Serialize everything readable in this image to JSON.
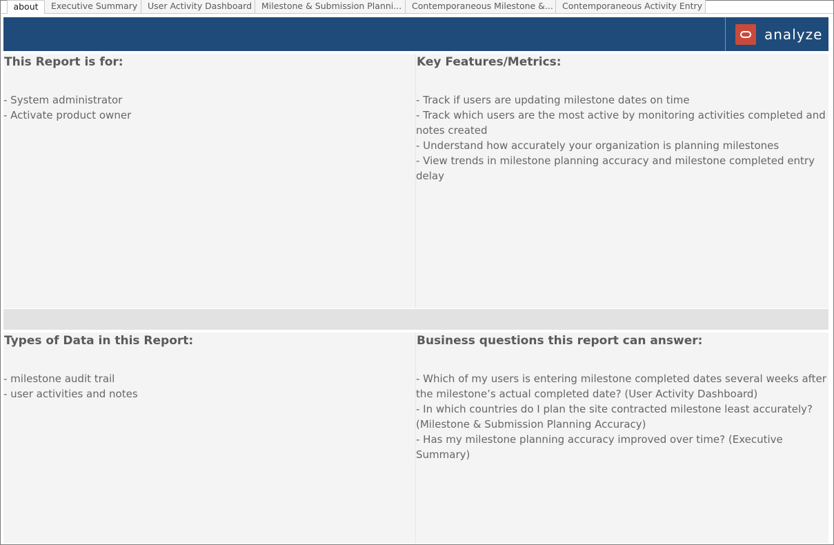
{
  "tabs": [
    {
      "label": "about",
      "active": true
    },
    {
      "label": "Executive Summary",
      "active": false
    },
    {
      "label": "User Activity Dashboard",
      "active": false
    },
    {
      "label": "Milestone & Submission Planni...",
      "active": false
    },
    {
      "label": "Contemporaneous Milestone &...",
      "active": false
    },
    {
      "label": "Contemporaneous Activity Entry",
      "active": false
    }
  ],
  "banner": {
    "brand_text": "analyze",
    "accent_color": "#1e4b7a",
    "logo_color": "#c94a3b",
    "logo_icon": "oracle-ring-icon"
  },
  "sections": {
    "report_for": {
      "title": "This Report is for:",
      "items": [
        "- System administrator",
        "- Activate product owner"
      ]
    },
    "key_features": {
      "title": "Key Features/Metrics:",
      "items": [
        "- Track if users are updating milestone dates on time",
        "- Track which users are the most active by monitoring activities completed and notes created",
        "- Understand how accurately your organization is planning milestones",
        "- View trends in milestone planning accuracy and milestone completed entry delay"
      ]
    },
    "data_types": {
      "title": "Types of Data in this Report:",
      "items": [
        "- milestone audit trail",
        "- user activities and notes"
      ]
    },
    "business_questions": {
      "title": "Business questions this report can answer:",
      "items": [
        "- Which of my users is entering milestone completed dates several weeks after the milestone’s actual completed date? (User Activity Dashboard)",
        "- In which countries do I plan the site contracted milestone least accurately? (Milestone & Submission Planning Accuracy)",
        "- Has my milestone planning accuracy improved over time? (Executive Summary)"
      ]
    }
  }
}
